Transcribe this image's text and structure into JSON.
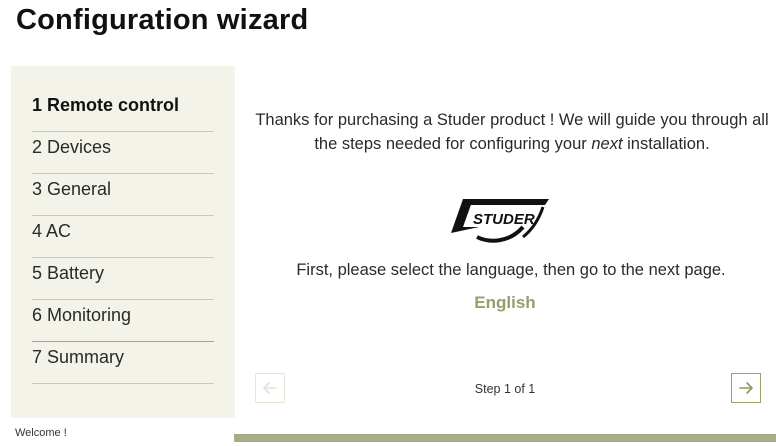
{
  "title": "Configuration wizard",
  "steps": [
    {
      "label": "1 Remote control"
    },
    {
      "label": "2 Devices"
    },
    {
      "label": "3 General"
    },
    {
      "label": "4 AC"
    },
    {
      "label": "5 Battery"
    },
    {
      "label": "6 Monitoring"
    },
    {
      "label": "7 Summary"
    }
  ],
  "content": {
    "intro_part1": "Thanks for purchasing a Studer product ! We will guide you through all the steps needed for configuring your ",
    "intro_emphasis": "next",
    "intro_part2": " installation.",
    "logo_text": "STUDER",
    "prompt": "First, please select the language, then go to the next page.",
    "language": "English",
    "step_counter": "Step 1 of 1"
  },
  "footer": {
    "label": "Welcome !"
  },
  "colors": {
    "sidebar_bg": "#f3f3ea",
    "accent": "#93a06a",
    "footer_bar": "#a7ad84"
  },
  "icons": {
    "prev": "arrow-left-icon",
    "next": "arrow-right-icon",
    "logo": "studer-logo"
  }
}
